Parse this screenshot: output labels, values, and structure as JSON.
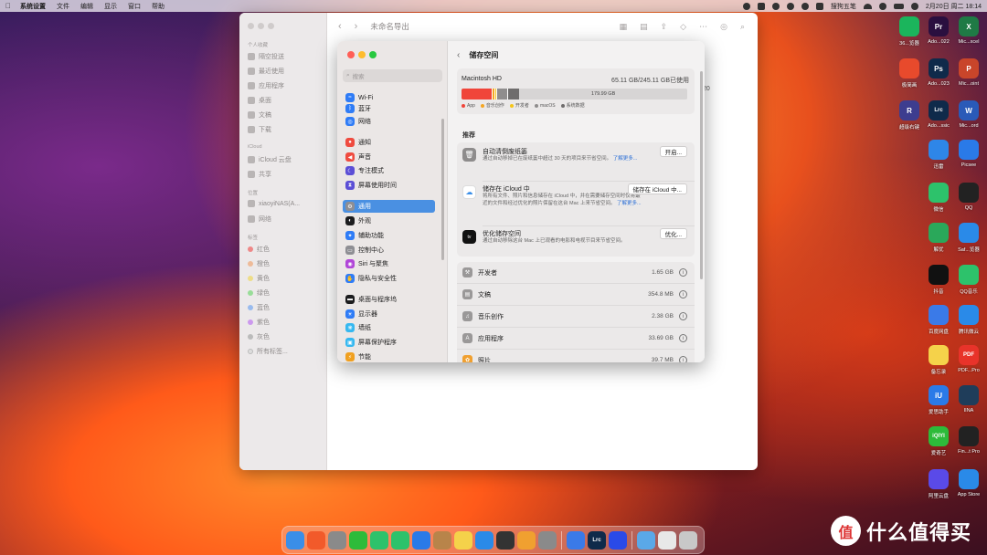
{
  "menubar": {
    "apple": "",
    "app": "系统设置",
    "items": [
      "文件",
      "编辑",
      "显示",
      "窗口",
      "帮助"
    ],
    "input_method": "搜狗五笔",
    "datetime": "2月20日 周二  18:14"
  },
  "finder": {
    "title": "未命名导出",
    "sections": {
      "favorites": "个人收藏",
      "icloud": "iCloud",
      "locations": "位置",
      "tags": "标签"
    },
    "favorites": [
      "隔空投送",
      "最近使用",
      "应用程序",
      "桌面",
      "文稿",
      "下载"
    ],
    "icloud": [
      "iCloud 云盘",
      "共享"
    ],
    "locations": [
      "xiaoyiNAS(A...",
      "网络"
    ],
    "tags": [
      "红色",
      "橙色",
      "黄色",
      "绿色",
      "蓝色",
      "紫色",
      "灰色",
      "所有标签..."
    ],
    "extra": "20"
  },
  "settings": {
    "search_placeholder": "搜索",
    "sidebar": [
      {
        "label": "Wi-Fi",
        "color": "#2f7cf6",
        "icon": "wifi-icon"
      },
      {
        "label": "蓝牙",
        "color": "#2f7cf6",
        "icon": "bluetooth-icon"
      },
      {
        "label": "网络",
        "color": "#2f7cf6",
        "icon": "globe-icon"
      },
      {
        "label": "通知",
        "color": "#ef4b3f",
        "icon": "bell-icon"
      },
      {
        "label": "声音",
        "color": "#ef4b3f",
        "icon": "speaker-icon"
      },
      {
        "label": "专注模式",
        "color": "#5c4fd6",
        "icon": "moon-icon"
      },
      {
        "label": "屏幕使用时间",
        "color": "#5c4fd6",
        "icon": "hourglass-icon"
      },
      {
        "label": "通用",
        "color": "#8e8e93",
        "icon": "gear-icon"
      },
      {
        "label": "外观",
        "color": "#1c1c1e",
        "icon": "appearance-icon"
      },
      {
        "label": "辅助功能",
        "color": "#2f7cf6",
        "icon": "accessibility-icon"
      },
      {
        "label": "控制中心",
        "color": "#8e8e93",
        "icon": "control-center-icon"
      },
      {
        "label": "Siri 与聚焦",
        "color": "#b146d8",
        "icon": "siri-icon"
      },
      {
        "label": "隐私与安全性",
        "color": "#2f7cf6",
        "icon": "hand-icon"
      },
      {
        "label": "桌面与程序坞",
        "color": "#1c1c1e",
        "icon": "dock-icon"
      },
      {
        "label": "显示器",
        "color": "#2f7cf6",
        "icon": "display-icon"
      },
      {
        "label": "墙纸",
        "color": "#36b8f0",
        "icon": "wallpaper-icon"
      },
      {
        "label": "屏幕保护程序",
        "color": "#36b8f0",
        "icon": "screensaver-icon"
      },
      {
        "label": "节能",
        "color": "#f0a020",
        "icon": "energy-icon"
      }
    ],
    "page_title": "储存空间",
    "disk": {
      "name": "Macintosh HD",
      "usage": "65.11 GB/245.11 GB已使用",
      "free_label": "179.99 GB",
      "segments": [
        {
          "name": "App",
          "color": "#f0453a",
          "fraction": 0.135
        },
        {
          "name": "音乐创作",
          "color": "#f5a623",
          "fraction": 0.01
        },
        {
          "name": "开发者",
          "color": "#f5c518",
          "fraction": 0.008
        },
        {
          "name": "macOS",
          "color": "#8f8d8d",
          "fraction": 0.048
        },
        {
          "name": "系统数据",
          "color": "#6f6d6d",
          "fraction": 0.055
        }
      ]
    },
    "recommend_title": "推荐",
    "recommendations": [
      {
        "title": "自动清倒废纸篓",
        "desc": "通过自动移掉已在废纸篓中超过 30 天的项目来节省空间。",
        "link": "了解更多...",
        "button": "开启...",
        "icon": "trash-icon",
        "color": "#8e8c8c"
      },
      {
        "title": "储存在 iCloud 中",
        "desc": "将所有文件、照片和信息储存在 iCloud 中，并在需要储存空间时仅将最近的文件和经过优化的照片保留在这台 Mac 上来节省空间。",
        "link": "了解更多...",
        "button": "储存在 iCloud 中...",
        "icon": "cloud-icon",
        "color": "#ffffff"
      },
      {
        "title": "优化储存空间",
        "desc": "通过自动移除这台 Mac 上已观看的电影和电视节目来节省空间。",
        "link": "",
        "button": "优化...",
        "icon": "apple-tv-icon",
        "color": "#111111"
      }
    ],
    "categories": [
      {
        "label": "开发者",
        "size": "1.65 GB",
        "icon": "hammer-icon"
      },
      {
        "label": "文稿",
        "size": "354.8 MB",
        "icon": "document-icon"
      },
      {
        "label": "音乐创作",
        "size": "2.38 GB",
        "icon": "music-icon"
      },
      {
        "label": "应用程序",
        "size": "33.69 GB",
        "icon": "apps-icon"
      },
      {
        "label": "照片",
        "size": "39.7 MB",
        "icon": "photos-icon"
      }
    ]
  },
  "desktop": [
    {
      "label": "36...览器",
      "color": "#1bb55c",
      "icon": "browser-icon"
    },
    {
      "label": "Ado...022",
      "color": "#2a0f3f",
      "icon": "premiere-icon",
      "text": "Pr"
    },
    {
      "label": "Mic...xcel",
      "color": "#1f7a45",
      "icon": "excel-icon",
      "text": "X"
    },
    {
      "label": "极简画",
      "color": "#e84a2c",
      "icon": "paint-icon"
    },
    {
      "label": "Ado...023",
      "color": "#0f2a4a",
      "icon": "photoshop-icon",
      "text": "Ps"
    },
    {
      "label": "Mic...oint",
      "color": "#c9452a",
      "icon": "powerpoint-icon",
      "text": "P"
    },
    {
      "label": "超级右键",
      "color": "#3d3d8f",
      "icon": "right-click-icon",
      "text": "R"
    },
    {
      "label": "Ado...ssic",
      "color": "#0f2a4a",
      "icon": "lightroom-icon",
      "text": "Lrc"
    },
    {
      "label": "Mic...ord",
      "color": "#2a5ab8",
      "icon": "word-icon",
      "text": "W"
    },
    {
      "label": "迅雷",
      "color": "#2e86e8",
      "icon": "thunder-icon"
    },
    {
      "label": "Picsee",
      "color": "#2a7ae8",
      "icon": "picsee-icon"
    },
    {
      "label": "微信",
      "color": "#2dc26b",
      "icon": "wechat-icon"
    },
    {
      "label": "QQ",
      "color": "#222222",
      "icon": "qq-icon"
    },
    {
      "label": "解优",
      "color": "#2aa85a",
      "icon": "archive-icon"
    },
    {
      "label": "Saf...览器",
      "color": "#2a8ae8",
      "icon": "safari-icon"
    },
    {
      "label": "抖音",
      "color": "#111111",
      "icon": "tiktok-icon"
    },
    {
      "label": "QQ音乐",
      "color": "#2dc26b",
      "icon": "qqmusic-icon"
    },
    {
      "label": "百度网盘",
      "color": "#3a7ae8",
      "icon": "baidu-pan-icon"
    },
    {
      "label": "腾讯微云",
      "color": "#2a8ae8",
      "icon": "weiyun-icon"
    },
    {
      "label": "备忘录",
      "color": "#f5d24a",
      "icon": "notes-icon"
    },
    {
      "label": "PDF...Pro",
      "color": "#e8332a",
      "icon": "pdf-icon",
      "text": "PDF"
    },
    {
      "label": "爱思助手",
      "color": "#2a7ae8",
      "icon": "i4-icon",
      "text": "iU"
    },
    {
      "label": "IINA",
      "color": "#1f3d5a",
      "icon": "iina-icon"
    },
    {
      "label": "爱奇艺",
      "color": "#2dbb3a",
      "icon": "iqiyi-icon",
      "text": "iQIYI"
    },
    {
      "label": "Fin...t Pro",
      "color": "#222222",
      "icon": "finalcut-icon"
    },
    {
      "label": "阿里云盘",
      "color": "#5a4ae8",
      "icon": "aliyun-pan-icon"
    },
    {
      "label": "App Store",
      "color": "#2a8ae8",
      "icon": "app-store-icon"
    }
  ],
  "dock": [
    {
      "name": "finder-icon",
      "color": "#3a8ee8"
    },
    {
      "name": "browser-icon",
      "color": "#f25a2a"
    },
    {
      "name": "launchpad-icon",
      "color": "#8a8a8a"
    },
    {
      "name": "iqiyi-icon",
      "color": "#2dbb3a"
    },
    {
      "name": "messages-icon",
      "color": "#2dc26b"
    },
    {
      "name": "wechat-icon",
      "color": "#2dc26b"
    },
    {
      "name": "mail-icon",
      "color": "#2a7ae8"
    },
    {
      "name": "contacts-icon",
      "color": "#b8844a"
    },
    {
      "name": "notes-icon",
      "color": "#f5d24a"
    },
    {
      "name": "app-store-icon",
      "color": "#2a8ae8"
    },
    {
      "name": "calculator-icon",
      "color": "#333333"
    },
    {
      "name": "photos-icon",
      "color": "#f0a030"
    },
    {
      "name": "system-settings-icon",
      "color": "#8a8a8a"
    },
    {
      "name": "baidu-pan-icon",
      "color": "#3a7ae8"
    },
    {
      "name": "lightroom-icon",
      "color": "#0f2a4a",
      "text": "Lrc"
    },
    {
      "name": "app-icon",
      "color": "#2a4ae8"
    },
    {
      "name": "downloads-folder-icon",
      "color": "#5aa8e8"
    },
    {
      "name": "document-stack-icon",
      "color": "#e8e8e8"
    },
    {
      "name": "trash-icon",
      "color": "#c8c8c8"
    }
  ],
  "watermark": {
    "symbol": "值",
    "text": "什么值得买"
  }
}
